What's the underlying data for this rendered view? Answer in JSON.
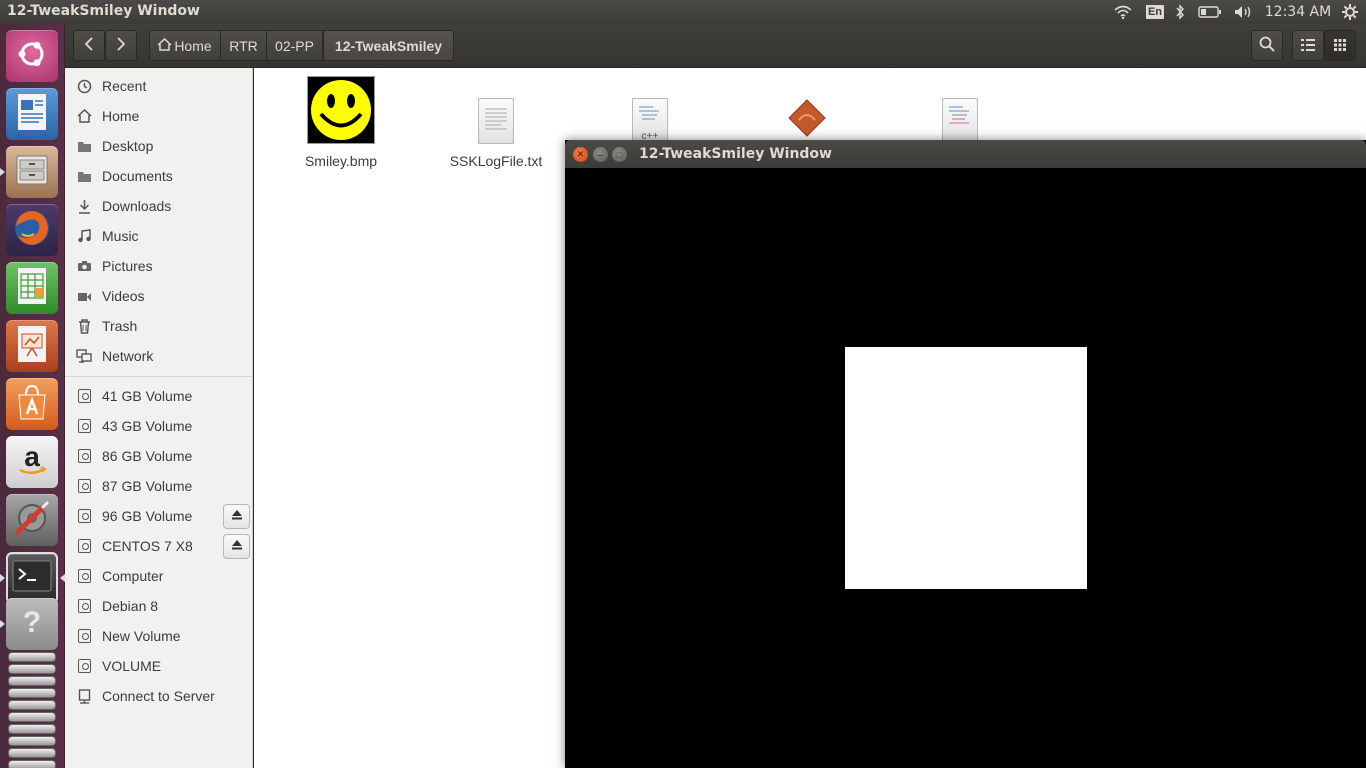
{
  "top_panel": {
    "title": "12-TweakSmiley Window",
    "keyboard_lang": "En",
    "clock": "12:34 AM",
    "icons": [
      "wifi-icon",
      "bluetooth-icon",
      "battery-icon",
      "volume-icon",
      "settings-gear-icon"
    ]
  },
  "launcher": {
    "items": [
      {
        "name": "ubuntu-dash",
        "icon": "ubuntu-logo-icon",
        "color": "#c9487f"
      },
      {
        "name": "libreoffice-writer",
        "icon": "writer-icon",
        "color": "#2f71b5"
      },
      {
        "name": "files",
        "icon": "file-cabinet-icon",
        "color": "#b88a6a"
      },
      {
        "name": "firefox",
        "icon": "firefox-icon",
        "color": "#e66000"
      },
      {
        "name": "libreoffice-calc",
        "icon": "calc-icon",
        "color": "#3f9c35"
      },
      {
        "name": "libreoffice-impress",
        "icon": "impress-icon",
        "color": "#c2512a"
      },
      {
        "name": "software-center",
        "icon": "shopping-bag-icon",
        "color": "#e8702a"
      },
      {
        "name": "amazon",
        "icon": "amazon-icon",
        "color": "#333333"
      },
      {
        "name": "system-settings",
        "icon": "tools-icon",
        "color": "#7a7a7a"
      },
      {
        "name": "terminal",
        "icon": "terminal-icon",
        "color": "#2c2c2c"
      },
      {
        "name": "help",
        "icon": "question-icon",
        "color": "#9a9a9a"
      }
    ]
  },
  "toolbar": {
    "breadcrumbs": [
      {
        "label": "Home",
        "icon": "home-icon"
      },
      {
        "label": "RTR"
      },
      {
        "label": "02-PP"
      },
      {
        "label": "12-TweakSmiley",
        "active": true
      }
    ],
    "icons": [
      "back-icon",
      "forward-icon",
      "search-icon",
      "list-view-icon",
      "grid-view-icon"
    ]
  },
  "sidebar": {
    "places": [
      {
        "label": "Recent",
        "icon": "clock-icon"
      },
      {
        "label": "Home",
        "icon": "home-icon"
      },
      {
        "label": "Desktop",
        "icon": "folder-icon"
      },
      {
        "label": "Documents",
        "icon": "folder-icon"
      },
      {
        "label": "Downloads",
        "icon": "download-icon"
      },
      {
        "label": "Music",
        "icon": "music-icon"
      },
      {
        "label": "Pictures",
        "icon": "camera-icon"
      },
      {
        "label": "Videos",
        "icon": "video-icon"
      },
      {
        "label": "Trash",
        "icon": "trash-icon"
      },
      {
        "label": "Network",
        "icon": "network-icon"
      }
    ],
    "devices": [
      {
        "label": "41 GB Volume"
      },
      {
        "label": "43 GB Volume"
      },
      {
        "label": "86 GB Volume"
      },
      {
        "label": "87 GB Volume"
      },
      {
        "label": "96 GB Volume",
        "eject": true
      },
      {
        "label": "CENTOS 7 X8",
        "eject": true
      },
      {
        "label": "Computer"
      },
      {
        "label": "Debian 8"
      },
      {
        "label": "New Volume"
      },
      {
        "label": "VOLUME"
      },
      {
        "label": "Connect to Server"
      }
    ]
  },
  "files": [
    {
      "label": "Smiley.bmp",
      "icon": "smiley-image-icon"
    },
    {
      "label": "SSKLogFile.txt",
      "icon": "text-file-icon"
    },
    {
      "label": "",
      "icon": "cpp-file-icon"
    },
    {
      "label": "",
      "icon": "executable-icon"
    },
    {
      "label": "",
      "icon": "source-file-icon"
    }
  ],
  "gl_window": {
    "title": "12-TweakSmiley Window",
    "background_color": "#000000",
    "quad_color": "#ffffff"
  }
}
